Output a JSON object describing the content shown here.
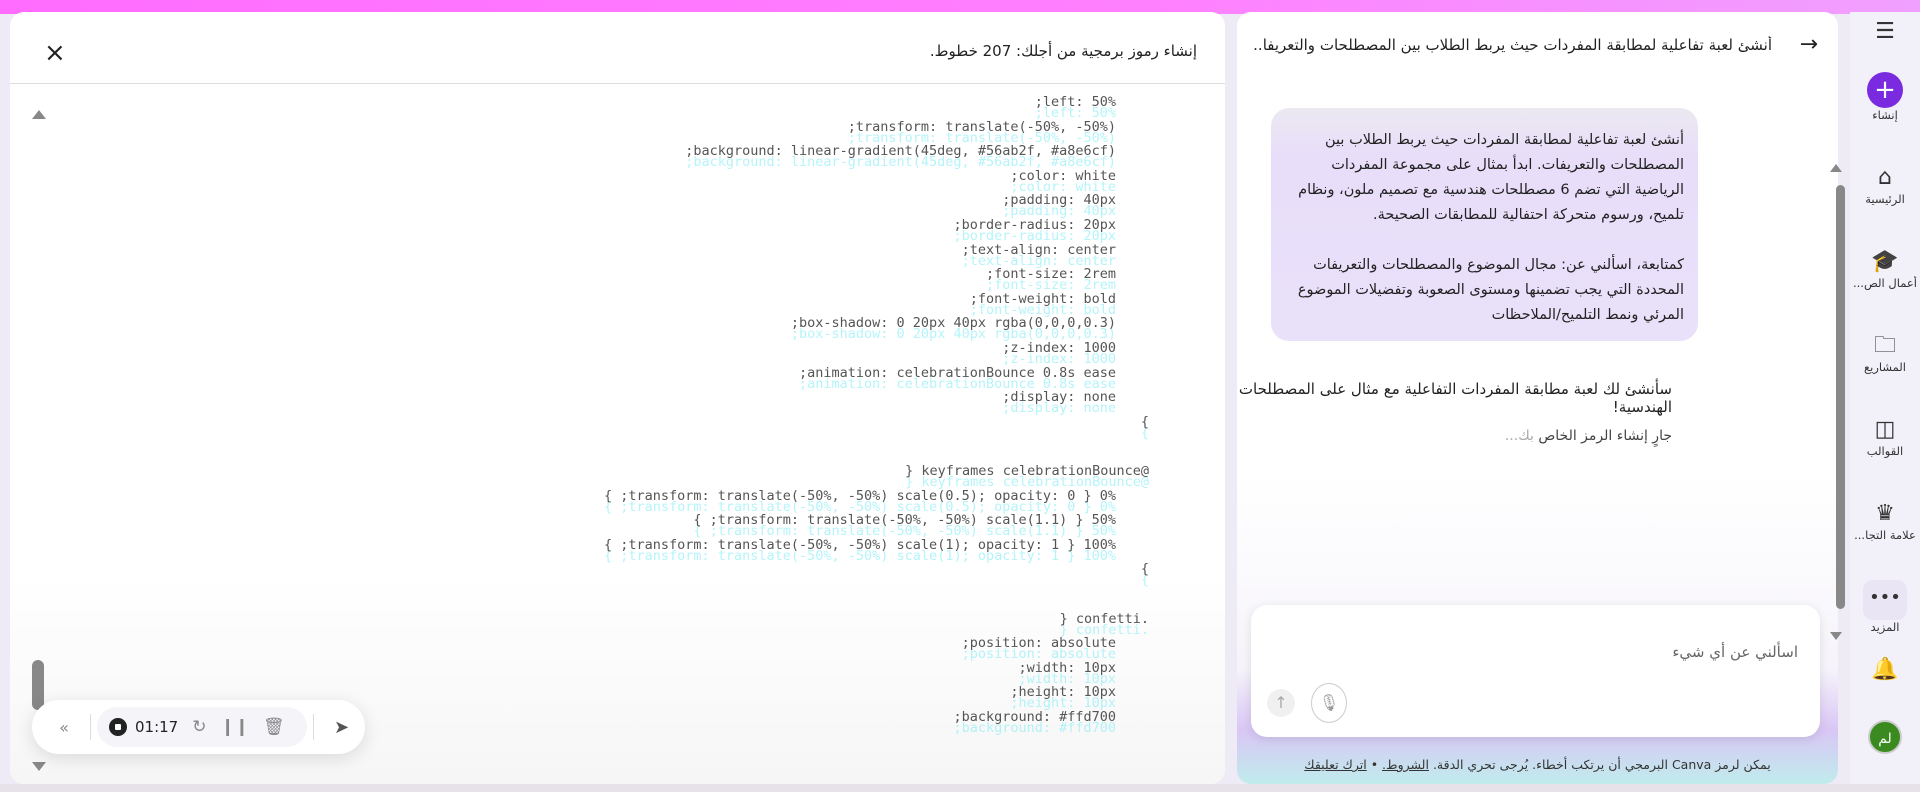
{
  "code_panel": {
    "title": "إنشاء رموز برمجية من أجلك: 207 خطوط.",
    "close_icon": "×",
    "lines": [
      ";left: 50%",
      ";transform: translate(-50%, -50%)",
      ";background: linear-gradient(45deg, #56ab2f, #a8e6cf)",
      ";color: white",
      ";padding: 40px",
      ";border-radius: 20px",
      ";text-align: center",
      ";font-size: 2rem",
      ";font-weight: bold",
      ";box-shadow: 0 20px 40px rgba(0,0,0,0.3)",
      ";z-index: 1000",
      ";animation: celebrationBounce 0.8s ease",
      ";display: none",
      "{",
      "",
      "} keyframes celebrationBounce@",
      "{ ;transform: translate(-50%, -50%) scale(0.5); opacity: 0 } 0%",
      "{ ;transform: translate(-50%, -50%) scale(1.1) } 50%",
      "{ ;transform: translate(-50%, -50%) scale(1); opacity: 1 } 100%",
      "{",
      "",
      "} confetti.",
      ";position: absolute",
      ";width: 10px",
      ";height: 10px",
      ";background: #ffd700"
    ]
  },
  "recorder": {
    "collapse": "«",
    "time": "01:17",
    "restart": "↻",
    "pause": "❙❙",
    "delete": "🗑",
    "cursor": "➤"
  },
  "chat": {
    "back_icon": "→",
    "title": "أنشئ لعبة تفاعلية لمطابقة المفردات حيث يربط الطلاب بين المصطلحات والتعريفا...",
    "user_message_p1": "أنشئ لعبة تفاعلية لمطابقة المفردات حيث يربط الطلاب بين المصطلحات والتعريفات. ابدأ بمثال على مجموعة المفردات الرياضية التي تضم 6 مصطلحات هندسية مع تصميم ملون، ونظام تلميح، ورسوم متحركة احتفالية للمطابقات الصحيحة.",
    "user_message_p2": "كمتابعة، اسألني عن: مجال الموضوع والمصطلحات والتعريفات المحددة التي يجب تضمينها ومستوى الصعوبة وتفضيلات الموضوع المرئي ونمط التلميح/الملاحظات",
    "assistant_message": "سأنشئ لك لعبة مطابقة المفردات التفاعلية مع مثال على المصطلحات الهندسية!",
    "generating": "جارٍ إنشاء الرمز الخاص",
    "generating_suffix": "بك...",
    "input_placeholder": "اسألني عن أي شيء",
    "send_icon": "↑",
    "mic_icon": "🎙",
    "footer_text": "يمكن لرمز Canva البرمجي أن يرتكب أخطاء. يُرجى تحري الدقة.",
    "footer_terms": "الشروط.",
    "footer_sep": "•",
    "footer_feedback": "اترك تعليقك"
  },
  "sidebar": {
    "menu_icon": "☰",
    "items": [
      {
        "label": "إنشاء",
        "icon": "+"
      },
      {
        "label": "الرئيسية",
        "icon": "⌂"
      },
      {
        "label": "أعمال الص...",
        "icon": "🎓"
      },
      {
        "label": "المشاريع",
        "icon": "🗀"
      },
      {
        "label": "القوالب",
        "icon": "◫"
      },
      {
        "label": "علامة التجا...",
        "icon": "♛"
      },
      {
        "label": "المزيد",
        "icon": "•••"
      }
    ],
    "bell_icon": "🔔",
    "avatar": "لم"
  }
}
